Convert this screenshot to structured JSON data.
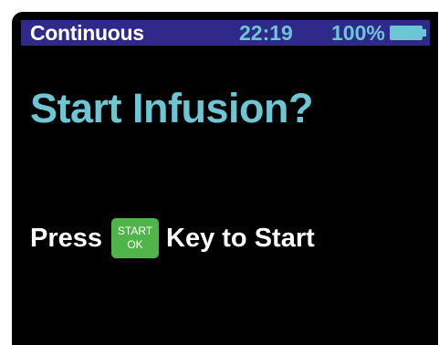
{
  "status_bar": {
    "mode": "Continuous",
    "time": "22:19",
    "battery_percent": "100%",
    "battery_icon": "battery-full-icon",
    "battery_level": 1.0
  },
  "main": {
    "title": "Start Infusion?",
    "prompt_before": "Press",
    "key_line1": "START",
    "key_line2": "OK",
    "prompt_after": "Key to Start"
  },
  "colors": {
    "background": "#000000",
    "status_bar": "#2f2a8a",
    "accent": "#6cc6d4",
    "key_green": "#4fb548",
    "text": "#ffffff"
  }
}
